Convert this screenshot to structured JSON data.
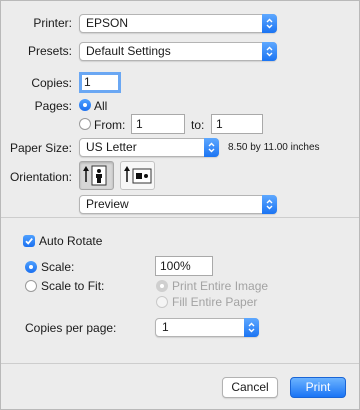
{
  "printer": {
    "label": "Printer:",
    "value": "EPSON"
  },
  "presets": {
    "label": "Presets:",
    "value": "Default Settings"
  },
  "copies": {
    "label": "Copies:",
    "value": "1"
  },
  "pages": {
    "label": "Pages:",
    "all_label": "All",
    "from_label": "From:",
    "from_value": "1",
    "to_label": "to:",
    "to_value": "1",
    "selected": "All"
  },
  "paper_size": {
    "label": "Paper Size:",
    "value": "US Letter",
    "dimensions": "8.50 by 11.00 inches"
  },
  "orientation": {
    "label": "Orientation:",
    "selected": "portrait",
    "icons": [
      "portrait-orientation-icon",
      "landscape-orientation-icon"
    ]
  },
  "section": {
    "value": "Preview"
  },
  "auto_rotate": {
    "label": "Auto Rotate",
    "checked": true
  },
  "scale": {
    "label": "Scale:",
    "value": "100%",
    "selected": true
  },
  "scale_to_fit": {
    "label": "Scale to Fit:",
    "print_entire_image": "Print Entire Image",
    "fill_entire_paper": "Fill Entire Paper"
  },
  "copies_per_page": {
    "label": "Copies per page:",
    "value": "1"
  },
  "buttons": {
    "cancel": "Cancel",
    "print": "Print"
  },
  "colors": {
    "accent": "#1b74f3",
    "focus_ring": "#6aa7f3",
    "background": "#ececec"
  }
}
